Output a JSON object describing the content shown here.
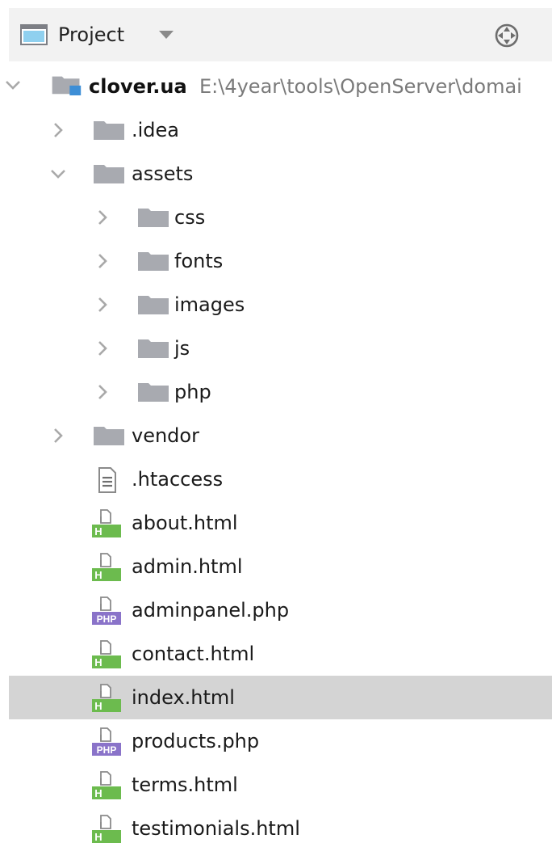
{
  "header": {
    "title": "Project",
    "icon": "project-view-icon",
    "dropdown_icon": "caret-down-icon",
    "locate_icon": "crosshair-icon"
  },
  "tree": {
    "root": {
      "name": "clover.ua",
      "path": "E:\\4year\\tools\\OpenServer\\domai",
      "expanded": true
    },
    "items": [
      {
        "label": ".idea",
        "kind": "folder",
        "depth": 1,
        "expanded": false
      },
      {
        "label": "assets",
        "kind": "folder",
        "depth": 1,
        "expanded": true
      },
      {
        "label": "css",
        "kind": "folder",
        "depth": 2,
        "expanded": false
      },
      {
        "label": "fonts",
        "kind": "folder",
        "depth": 2,
        "expanded": false
      },
      {
        "label": "images",
        "kind": "folder",
        "depth": 2,
        "expanded": false
      },
      {
        "label": "js",
        "kind": "folder",
        "depth": 2,
        "expanded": false
      },
      {
        "label": "php",
        "kind": "folder",
        "depth": 2,
        "expanded": false
      },
      {
        "label": "vendor",
        "kind": "folder",
        "depth": 1,
        "expanded": false
      },
      {
        "label": ".htaccess",
        "kind": "text",
        "depth": 1
      },
      {
        "label": "about.html",
        "kind": "html",
        "depth": 1
      },
      {
        "label": "admin.html",
        "kind": "html",
        "depth": 1
      },
      {
        "label": "adminpanel.php",
        "kind": "php",
        "depth": 1
      },
      {
        "label": "contact.html",
        "kind": "html",
        "depth": 1
      },
      {
        "label": "index.html",
        "kind": "html",
        "depth": 1,
        "selected": true
      },
      {
        "label": "products.php",
        "kind": "php",
        "depth": 1
      },
      {
        "label": "terms.html",
        "kind": "html",
        "depth": 1
      },
      {
        "label": "testimonials.html",
        "kind": "html",
        "depth": 1
      }
    ]
  },
  "badges": {
    "html": "H",
    "php": "PHP"
  },
  "colors": {
    "header_bg": "#f2f2f2",
    "selected_bg": "#d4d4d4",
    "folder": "#a8aab0",
    "module_badge": "#3d8ed6",
    "html_badge": "#6cbb4e",
    "php_badge": "#8a73c9",
    "path_text": "#7a7a7a"
  }
}
